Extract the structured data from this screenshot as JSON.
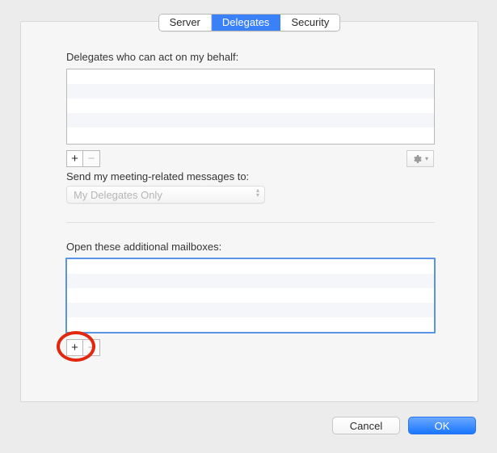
{
  "tabs": {
    "server": "Server",
    "delegates": "Delegates",
    "security": "Security"
  },
  "delegates_section": {
    "heading": "Delegates who can act on my behalf:",
    "add_label": "+",
    "remove_label": "−",
    "gear_icon": "gear-icon",
    "send_label": "Send my meeting-related messages to:",
    "send_selected": "My Delegates Only"
  },
  "mailboxes_section": {
    "heading": "Open these additional mailboxes:",
    "add_label": "+",
    "remove_label": "−"
  },
  "footer": {
    "cancel": "Cancel",
    "ok": "OK"
  }
}
